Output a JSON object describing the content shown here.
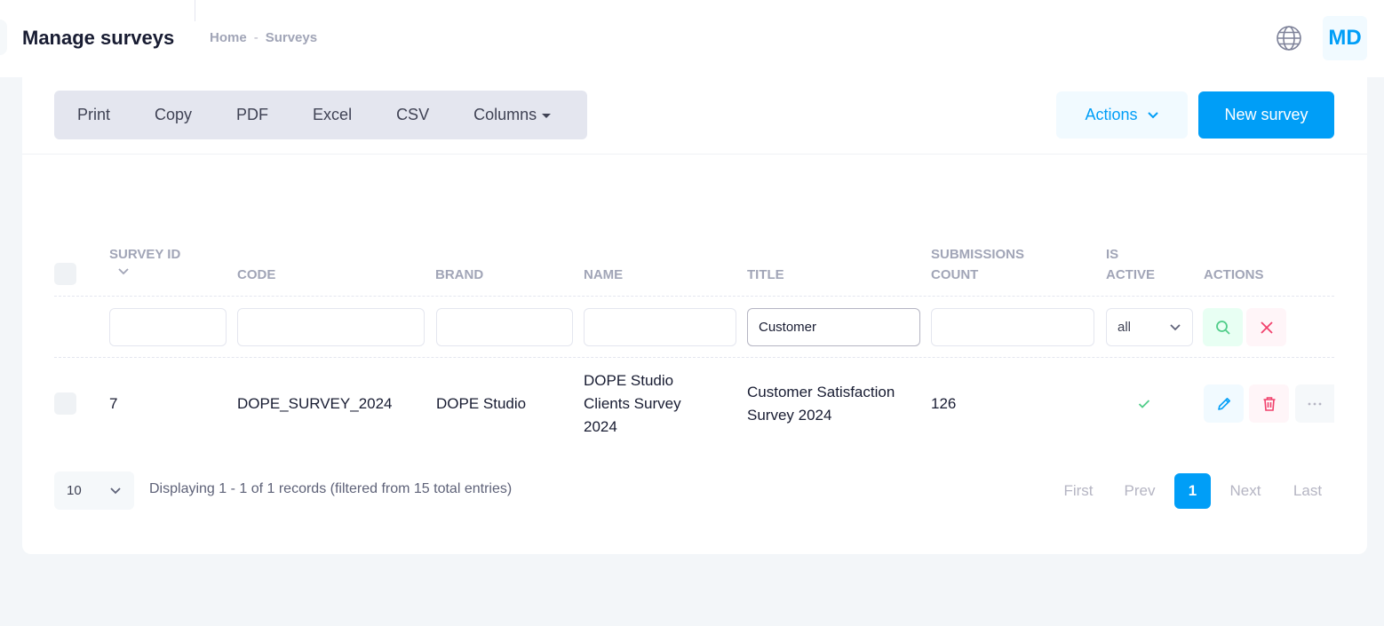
{
  "header": {
    "title": "Manage surveys",
    "breadcrumb": {
      "home": "Home",
      "separator": "-",
      "current": "Surveys"
    },
    "user_initials": "MD"
  },
  "toolbar": {
    "print": "Print",
    "copy": "Copy",
    "pdf": "PDF",
    "excel": "Excel",
    "csv": "CSV",
    "columns": "Columns",
    "actions": "Actions",
    "new_survey": "New survey"
  },
  "table": {
    "columns": {
      "survey_id": "Survey ID",
      "code": "Code",
      "brand": "Brand",
      "name": "Name",
      "title": "Title",
      "submissions_1": "Submissions",
      "submissions_2": "Count",
      "is_active_1": "Is",
      "is_active_2": "Active",
      "actions": "Actions"
    },
    "filters": {
      "title_value": "Customer",
      "is_active_selected": "all"
    },
    "rows": [
      {
        "survey_id": "7",
        "code": "DOPE_SURVEY_2024",
        "brand": "DOPE Studio",
        "name_lines": [
          "DOPE Studio",
          "Clients Survey",
          "2024"
        ],
        "title_lines": [
          "Customer Satisfaction",
          "Survey 2024"
        ],
        "submissions_count": "126",
        "is_active": true
      }
    ]
  },
  "footer": {
    "page_size": "10",
    "info": "Displaying 1 - 1 of 1 records (filtered from 15 total entries)",
    "pagination": {
      "first": "First",
      "prev": "Prev",
      "current": "1",
      "next": "Next",
      "last": "Last"
    }
  },
  "colors": {
    "primary": "#009ef7",
    "success": "#50cd89",
    "danger": "#f1416c",
    "muted": "#a1a5b7"
  },
  "icons": [
    "globe-icon",
    "chevron-down-icon",
    "sort-icon",
    "search-icon",
    "close-icon",
    "edit-icon",
    "trash-icon",
    "more-icon",
    "check-icon"
  ]
}
